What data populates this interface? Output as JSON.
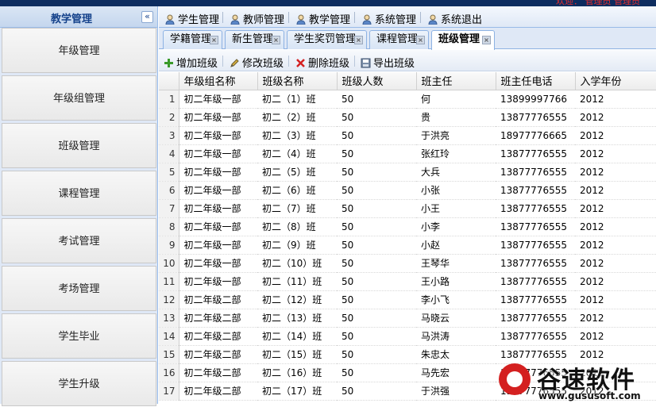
{
  "header": {
    "welcome": "欢迎：  管理员 管理员"
  },
  "sidebar": {
    "title": "教学管理",
    "collapse_glyph": "«",
    "items": [
      {
        "label": "年级管理"
      },
      {
        "label": "年级组管理"
      },
      {
        "label": "班级管理"
      },
      {
        "label": "课程管理"
      },
      {
        "label": "考试管理"
      },
      {
        "label": "考场管理"
      },
      {
        "label": "学生毕业"
      },
      {
        "label": "学生升级"
      }
    ]
  },
  "menubar": {
    "items": [
      {
        "label": "学生管理",
        "icon": "user-icon"
      },
      {
        "label": "教师管理",
        "icon": "user-icon"
      },
      {
        "label": "教学管理",
        "icon": "user-icon"
      },
      {
        "label": "系统管理",
        "icon": "user-icon"
      },
      {
        "label": "系统退出",
        "icon": "user-icon"
      }
    ]
  },
  "tabs": [
    {
      "label": "学籍管理",
      "active": false
    },
    {
      "label": "新生管理",
      "active": false
    },
    {
      "label": "学生奖罚管理",
      "active": false
    },
    {
      "label": "课程管理",
      "active": false
    },
    {
      "label": "班级管理",
      "active": true
    }
  ],
  "toolbar": {
    "add": "增加班级",
    "edit": "修改班级",
    "delete": "删除班级",
    "export": "导出班级"
  },
  "colors": {
    "accent": "#15428b",
    "border": "#99bbe8",
    "panel": "#dfe8f6"
  },
  "grid": {
    "columns": [
      "年级组名称",
      "班级名称",
      "班级人数",
      "班主任",
      "班主任电话",
      "入学年份"
    ],
    "rows": [
      [
        "1",
        "初二年级一部",
        "初二（1）班",
        "50",
        "何",
        "13899997766",
        "2012"
      ],
      [
        "2",
        "初二年级一部",
        "初二（2）班",
        "50",
        "贵",
        "13877776555",
        "2012"
      ],
      [
        "3",
        "初二年级一部",
        "初二（3）班",
        "50",
        "于洪亮",
        "18977776665",
        "2012"
      ],
      [
        "4",
        "初二年级一部",
        "初二（4）班",
        "50",
        "张红玲",
        "13877776555",
        "2012"
      ],
      [
        "5",
        "初二年级一部",
        "初二（5）班",
        "50",
        "大兵",
        "13877776555",
        "2012"
      ],
      [
        "6",
        "初二年级一部",
        "初二（6）班",
        "50",
        "小张",
        "13877776555",
        "2012"
      ],
      [
        "7",
        "初二年级一部",
        "初二（7）班",
        "50",
        "小王",
        "13877776555",
        "2012"
      ],
      [
        "8",
        "初二年级一部",
        "初二（8）班",
        "50",
        "小李",
        "13877776555",
        "2012"
      ],
      [
        "9",
        "初二年级一部",
        "初二（9）班",
        "50",
        "小赵",
        "13877776555",
        "2012"
      ],
      [
        "10",
        "初二年级一部",
        "初二（10）班",
        "50",
        "王琴华",
        "13877776555",
        "2012"
      ],
      [
        "11",
        "初二年级一部",
        "初二（11）班",
        "50",
        "王小路",
        "13877776555",
        "2012"
      ],
      [
        "12",
        "初二年级二部",
        "初二（12）班",
        "50",
        "李小飞",
        "13877776555",
        "2012"
      ],
      [
        "13",
        "初二年级二部",
        "初二（13）班",
        "50",
        "马晓云",
        "13877776555",
        "2012"
      ],
      [
        "14",
        "初二年级二部",
        "初二（14）班",
        "50",
        "马洪涛",
        "13877776555",
        "2012"
      ],
      [
        "15",
        "初二年级二部",
        "初二（15）班",
        "50",
        "朱忠太",
        "13877776555",
        "2012"
      ],
      [
        "16",
        "初二年级二部",
        "初二（16）班",
        "50",
        "马先宏",
        "13877776555",
        "2012"
      ],
      [
        "17",
        "初二年级二部",
        "初二（17）班",
        "50",
        "于洪强",
        "13877776555",
        "2012"
      ]
    ]
  },
  "watermark": {
    "text": "谷速软件",
    "url": "www.gususoft.com"
  }
}
